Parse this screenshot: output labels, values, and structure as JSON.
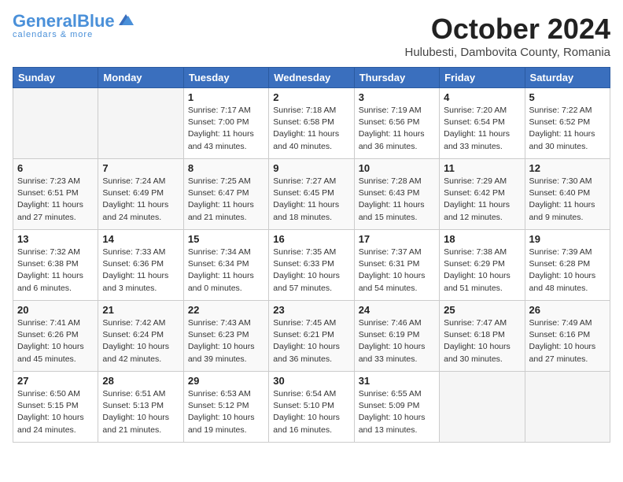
{
  "header": {
    "logo_general": "General",
    "logo_blue": "Blue",
    "month": "October 2024",
    "location": "Hulubesti, Dambovita County, Romania"
  },
  "weekdays": [
    "Sunday",
    "Monday",
    "Tuesday",
    "Wednesday",
    "Thursday",
    "Friday",
    "Saturday"
  ],
  "weeks": [
    [
      {
        "day": "",
        "sunrise": "",
        "sunset": "",
        "daylight": ""
      },
      {
        "day": "",
        "sunrise": "",
        "sunset": "",
        "daylight": ""
      },
      {
        "day": "1",
        "sunrise": "Sunrise: 7:17 AM",
        "sunset": "Sunset: 7:00 PM",
        "daylight": "Daylight: 11 hours and 43 minutes."
      },
      {
        "day": "2",
        "sunrise": "Sunrise: 7:18 AM",
        "sunset": "Sunset: 6:58 PM",
        "daylight": "Daylight: 11 hours and 40 minutes."
      },
      {
        "day": "3",
        "sunrise": "Sunrise: 7:19 AM",
        "sunset": "Sunset: 6:56 PM",
        "daylight": "Daylight: 11 hours and 36 minutes."
      },
      {
        "day": "4",
        "sunrise": "Sunrise: 7:20 AM",
        "sunset": "Sunset: 6:54 PM",
        "daylight": "Daylight: 11 hours and 33 minutes."
      },
      {
        "day": "5",
        "sunrise": "Sunrise: 7:22 AM",
        "sunset": "Sunset: 6:52 PM",
        "daylight": "Daylight: 11 hours and 30 minutes."
      }
    ],
    [
      {
        "day": "6",
        "sunrise": "Sunrise: 7:23 AM",
        "sunset": "Sunset: 6:51 PM",
        "daylight": "Daylight: 11 hours and 27 minutes."
      },
      {
        "day": "7",
        "sunrise": "Sunrise: 7:24 AM",
        "sunset": "Sunset: 6:49 PM",
        "daylight": "Daylight: 11 hours and 24 minutes."
      },
      {
        "day": "8",
        "sunrise": "Sunrise: 7:25 AM",
        "sunset": "Sunset: 6:47 PM",
        "daylight": "Daylight: 11 hours and 21 minutes."
      },
      {
        "day": "9",
        "sunrise": "Sunrise: 7:27 AM",
        "sunset": "Sunset: 6:45 PM",
        "daylight": "Daylight: 11 hours and 18 minutes."
      },
      {
        "day": "10",
        "sunrise": "Sunrise: 7:28 AM",
        "sunset": "Sunset: 6:43 PM",
        "daylight": "Daylight: 11 hours and 15 minutes."
      },
      {
        "day": "11",
        "sunrise": "Sunrise: 7:29 AM",
        "sunset": "Sunset: 6:42 PM",
        "daylight": "Daylight: 11 hours and 12 minutes."
      },
      {
        "day": "12",
        "sunrise": "Sunrise: 7:30 AM",
        "sunset": "Sunset: 6:40 PM",
        "daylight": "Daylight: 11 hours and 9 minutes."
      }
    ],
    [
      {
        "day": "13",
        "sunrise": "Sunrise: 7:32 AM",
        "sunset": "Sunset: 6:38 PM",
        "daylight": "Daylight: 11 hours and 6 minutes."
      },
      {
        "day": "14",
        "sunrise": "Sunrise: 7:33 AM",
        "sunset": "Sunset: 6:36 PM",
        "daylight": "Daylight: 11 hours and 3 minutes."
      },
      {
        "day": "15",
        "sunrise": "Sunrise: 7:34 AM",
        "sunset": "Sunset: 6:34 PM",
        "daylight": "Daylight: 11 hours and 0 minutes."
      },
      {
        "day": "16",
        "sunrise": "Sunrise: 7:35 AM",
        "sunset": "Sunset: 6:33 PM",
        "daylight": "Daylight: 10 hours and 57 minutes."
      },
      {
        "day": "17",
        "sunrise": "Sunrise: 7:37 AM",
        "sunset": "Sunset: 6:31 PM",
        "daylight": "Daylight: 10 hours and 54 minutes."
      },
      {
        "day": "18",
        "sunrise": "Sunrise: 7:38 AM",
        "sunset": "Sunset: 6:29 PM",
        "daylight": "Daylight: 10 hours and 51 minutes."
      },
      {
        "day": "19",
        "sunrise": "Sunrise: 7:39 AM",
        "sunset": "Sunset: 6:28 PM",
        "daylight": "Daylight: 10 hours and 48 minutes."
      }
    ],
    [
      {
        "day": "20",
        "sunrise": "Sunrise: 7:41 AM",
        "sunset": "Sunset: 6:26 PM",
        "daylight": "Daylight: 10 hours and 45 minutes."
      },
      {
        "day": "21",
        "sunrise": "Sunrise: 7:42 AM",
        "sunset": "Sunset: 6:24 PM",
        "daylight": "Daylight: 10 hours and 42 minutes."
      },
      {
        "day": "22",
        "sunrise": "Sunrise: 7:43 AM",
        "sunset": "Sunset: 6:23 PM",
        "daylight": "Daylight: 10 hours and 39 minutes."
      },
      {
        "day": "23",
        "sunrise": "Sunrise: 7:45 AM",
        "sunset": "Sunset: 6:21 PM",
        "daylight": "Daylight: 10 hours and 36 minutes."
      },
      {
        "day": "24",
        "sunrise": "Sunrise: 7:46 AM",
        "sunset": "Sunset: 6:19 PM",
        "daylight": "Daylight: 10 hours and 33 minutes."
      },
      {
        "day": "25",
        "sunrise": "Sunrise: 7:47 AM",
        "sunset": "Sunset: 6:18 PM",
        "daylight": "Daylight: 10 hours and 30 minutes."
      },
      {
        "day": "26",
        "sunrise": "Sunrise: 7:49 AM",
        "sunset": "Sunset: 6:16 PM",
        "daylight": "Daylight: 10 hours and 27 minutes."
      }
    ],
    [
      {
        "day": "27",
        "sunrise": "Sunrise: 6:50 AM",
        "sunset": "Sunset: 5:15 PM",
        "daylight": "Daylight: 10 hours and 24 minutes."
      },
      {
        "day": "28",
        "sunrise": "Sunrise: 6:51 AM",
        "sunset": "Sunset: 5:13 PM",
        "daylight": "Daylight: 10 hours and 21 minutes."
      },
      {
        "day": "29",
        "sunrise": "Sunrise: 6:53 AM",
        "sunset": "Sunset: 5:12 PM",
        "daylight": "Daylight: 10 hours and 19 minutes."
      },
      {
        "day": "30",
        "sunrise": "Sunrise: 6:54 AM",
        "sunset": "Sunset: 5:10 PM",
        "daylight": "Daylight: 10 hours and 16 minutes."
      },
      {
        "day": "31",
        "sunrise": "Sunrise: 6:55 AM",
        "sunset": "Sunset: 5:09 PM",
        "daylight": "Daylight: 10 hours and 13 minutes."
      },
      {
        "day": "",
        "sunrise": "",
        "sunset": "",
        "daylight": ""
      },
      {
        "day": "",
        "sunrise": "",
        "sunset": "",
        "daylight": ""
      }
    ]
  ]
}
